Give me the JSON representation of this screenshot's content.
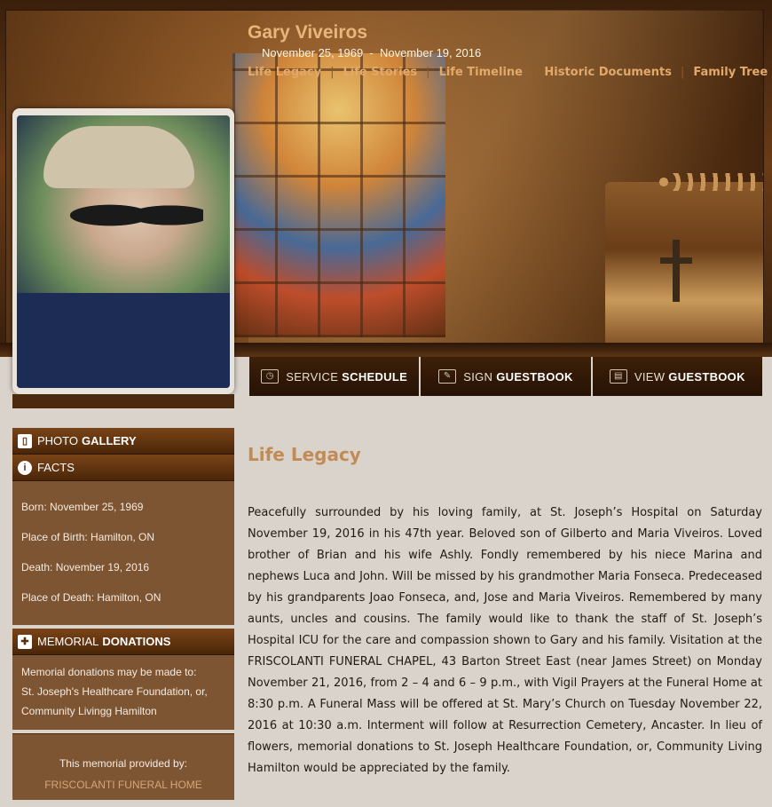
{
  "header": {
    "name": "Gary Viveiros",
    "birth_date": "November 25, 1969",
    "date_separator": "-",
    "death_date": "November 19, 2016",
    "nav": [
      {
        "label": "Life Legacy"
      },
      {
        "label": "Life Stories"
      },
      {
        "label": "Life Timeline"
      },
      {
        "label": "Historic Documents"
      },
      {
        "label": "Family Tree"
      }
    ]
  },
  "actions": {
    "service": {
      "light": "SERVICE",
      "bold": "SCHEDULE",
      "icon": "clock-icon"
    },
    "sign": {
      "light": "SIGN",
      "bold": "GUESTBOOK",
      "icon": "pen-book-icon"
    },
    "view": {
      "light": "VIEW",
      "bold": "GUESTBOOK",
      "icon": "open-book-icon"
    }
  },
  "sidebar": {
    "gallery": {
      "light": "PHOTO",
      "bold": "GALLERY"
    },
    "facts": {
      "title": "FACTS",
      "items": [
        "Born: November 25, 1969",
        "Place of Birth: Hamilton, ON",
        "Death: November 19, 2016",
        "Place of Death: Hamilton, ON"
      ]
    },
    "donations": {
      "light": "MEMORIAL",
      "bold": "DONATIONS",
      "lines": [
        "Memorial donations may be made to:",
        "St. Joseph's Healthcare Foundation, or,",
        "Community Livingg Hamilton"
      ]
    },
    "provided": {
      "label": "This memorial provided by:",
      "home": "FRISCOLANTI FUNERAL HOME"
    }
  },
  "main": {
    "title": "Life Legacy",
    "body": "Peacefully surrounded by his loving family, at St. Joseph’s Hospital on Saturday November 19, 2016 in his 47th year. Beloved son of Gilberto and Maria Viveiros. Loved brother of Brian and his wife Ashly. Fondly remembered by his niece Marina and nephews Luca and John. Will be missed by his grandmother Maria Fonseca. Predeceased by his grandparents Joao Fonseca, and, Jose and Maria Viveiros. Remembered by many aunts, uncles and cousins. The family would like to thank the staff of St. Joseph’s Hospital ICU for the care and compassion shown to Gary and his family. Visitation at the FRISCOLANTI FUNERAL CHAPEL, 43 Barton Street East (near James Street) on Monday November 21, 2016, from 2 – 4 and 6 – 9 p.m., with Vigil Prayers at the Funeral Home at 8:30 p.m.  A Funeral Mass will be offered at St. Mary’s Church on Tuesday November 22, 2016 at 10:30 a.m. Interment will follow at Resurrection Cemetery, Ancaster. In lieu of flowers, memorial donations to St. Joseph Healthcare Foundation, or, Community Living Hamilton would be appreciated by the family."
  }
}
